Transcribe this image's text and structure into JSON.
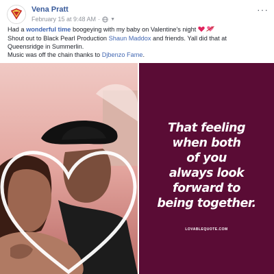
{
  "post": {
    "author": "Vena Pratt",
    "timestamp": "February 15 at 9:48 AM",
    "separator": "·",
    "privacy_icon": "globe-icon",
    "options_label": "···",
    "lines": {
      "l1_pre": "Had a ",
      "l1_bold": "wonderful time",
      "l1_post": " boogeying with my baby on Valentine's night",
      "l2_pre": "Shout out to Black Pearl Production ",
      "l2_link": "Shaun Maddox",
      "l2_post": " and friends. Yall did that at",
      "l3": "Queensridge in Summerlin.",
      "l4_pre": "Music was off the chain thanks to ",
      "l4_link": "Djbenzo Fame",
      "l4_post": "."
    }
  },
  "quote": {
    "lines": [
      "That feeling",
      "when both",
      "of you",
      "always look",
      "forward to",
      "being together."
    ],
    "credit": "LOVABLEQUOTE.COM"
  },
  "colors": {
    "link": "#4267b2",
    "author": "#365899",
    "quote_bg": "#5a0c35"
  }
}
